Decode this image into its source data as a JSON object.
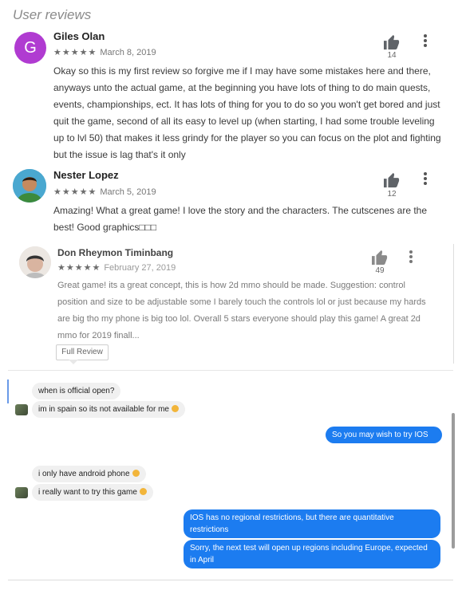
{
  "section_title": "User reviews",
  "reviews": [
    {
      "name": "Giles Olan",
      "avatar_letter": "G",
      "stars": "★★★★★",
      "date": "March 8, 2019",
      "likes": "14",
      "text": "Okay so this is my first review so forgive me if I may have some mistakes here and there, anyways unto the actual game, at the beginning you have lots of thing to do main quests, events, championships, ect. It has lots of thing for you to do so you won't get bored and just quit the game, second of all its easy to level up (when starting, I had some trouble leveling up to lvl 50) that makes it less grindy for the player so you can focus on the plot and fighting but the issue is lag that's it only"
    },
    {
      "name": "Nester Lopez",
      "stars": "★★★★★",
      "date": "March 5, 2019",
      "likes": "12",
      "text": "Amazing! What a great game! I love the story and the characters. The cutscenes are the best! Good graphics□□□"
    },
    {
      "name": "Don Rheymon Timinbang",
      "stars": "★★★★★",
      "date": "February 27, 2019",
      "likes": "49",
      "text": "Great game! its a great concept, this is how 2d mmo should be made. Suggestion: control position and size to be adjustable some I barely touch the controls lol or just because my hards are big tho my phone is big too lol. Overall 5 stars everyone should play this game! A great 2d mmo for 2019 finall...",
      "full_review_label": "Full Review"
    }
  ],
  "chat": {
    "messages": [
      {
        "side": "in",
        "text": "when is official open?"
      },
      {
        "side": "in",
        "text": "im in spain so its not available for me",
        "emoji": true
      },
      {
        "side": "out",
        "text": "So you may wish to try IOS"
      },
      {
        "side": "in",
        "text": "i only have android phone",
        "emoji": true
      },
      {
        "side": "in",
        "text": "i really want to try this game",
        "emoji": true
      },
      {
        "side": "out",
        "text": "IOS has no regional restrictions, but there are quantitative restrictions"
      },
      {
        "side": "out",
        "text": "Sorry, the next test will open up regions including Europe, expected in April"
      }
    ]
  },
  "colors": {
    "accent_blue": "#1c7cf0",
    "avatar_purple": "#b03bd1",
    "incoming_bubble": "#f0f0f0"
  },
  "icons": [
    "thumbs-up-icon",
    "more-vert-icon",
    "star-icon",
    "smile-emoji-icon"
  ]
}
